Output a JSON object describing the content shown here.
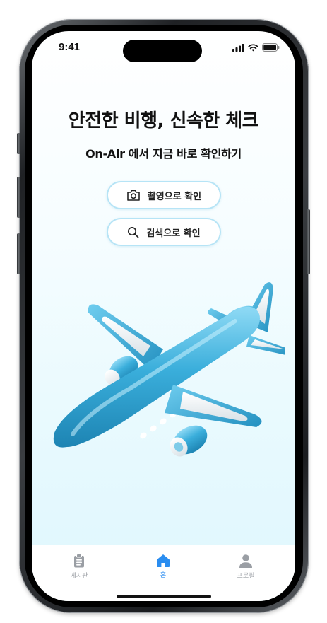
{
  "status_bar": {
    "time": "9:41",
    "icons": [
      "cellular-signal-icon",
      "wifi-icon",
      "battery-icon"
    ]
  },
  "hero": {
    "headline": "안전한 비행, 신속한 체크",
    "subline": "On-Air 에서 지금 바로 확인하기"
  },
  "actions": {
    "photo_label": "촬영으로 확인",
    "photo_icon": "camera-icon",
    "search_label": "검색으로 확인",
    "search_icon": "search-icon"
  },
  "illustration": {
    "name": "airplane-illustration",
    "colors": {
      "body": "#3aaedb",
      "accent": "#e9eef1"
    }
  },
  "tab_bar": {
    "tabs": [
      {
        "label": "게시판",
        "icon": "clipboard-icon",
        "active": false
      },
      {
        "label": "홈",
        "icon": "home-icon",
        "active": true
      },
      {
        "label": "프로필",
        "icon": "profile-icon",
        "active": false
      }
    ]
  },
  "colors": {
    "accent": "#2a8df0",
    "pill_border": "#b6e4f6",
    "inactive_tab": "#9a9ea4"
  }
}
